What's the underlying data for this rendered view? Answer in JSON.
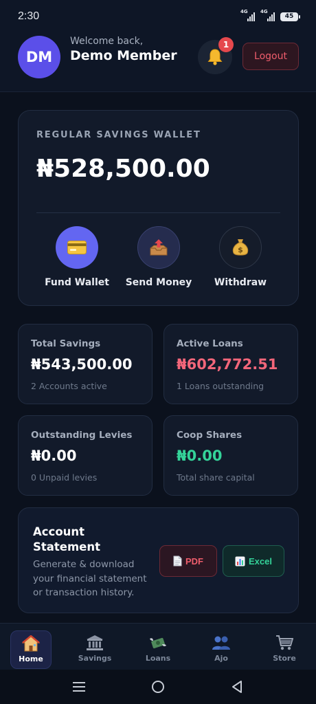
{
  "status_bar": {
    "time": "2:30",
    "signal1_label": "4G",
    "signal2_label": "4G",
    "battery": "45"
  },
  "header": {
    "avatar_initials": "DM",
    "welcome": "Welcome back,",
    "name": "Demo Member",
    "notification_count": "1",
    "logout_label": "Logout"
  },
  "wallet": {
    "label": "REGULAR SAVINGS WALLET",
    "balance": "₦528,500.00",
    "actions": [
      {
        "label": "Fund Wallet",
        "icon": "credit-card-icon",
        "color": "#6366f1"
      },
      {
        "label": "Send Money",
        "icon": "outbox-tray-icon",
        "color": "#252c4e"
      },
      {
        "label": "Withdraw",
        "icon": "money-bag-icon",
        "color": "#151c2a"
      }
    ]
  },
  "stats": [
    {
      "title": "Total Savings",
      "value": "₦543,500.00",
      "sub": "2 Accounts active",
      "color": "#ffffff"
    },
    {
      "title": "Active Loans",
      "value": "₦602,772.51",
      "sub": "1 Loans outstanding",
      "color": "#f2667a"
    },
    {
      "title": "Outstanding Levies",
      "value": "₦0.00",
      "sub": "0 Unpaid levies",
      "color": "#ffffff"
    },
    {
      "title": "Coop Shares",
      "value": "₦0.00",
      "sub": "Total share capital",
      "color": "#34d399"
    }
  ],
  "statement": {
    "title": "Account Statement",
    "description": "Generate & download your financial statement or transaction history.",
    "pdf_label": "PDF",
    "excel_label": "Excel"
  },
  "nav": {
    "items": [
      {
        "label": "Home",
        "icon": "house-icon",
        "active": true
      },
      {
        "label": "Savings",
        "icon": "bank-icon",
        "active": false
      },
      {
        "label": "Loans",
        "icon": "money-wings-icon",
        "active": false
      },
      {
        "label": "Ajo",
        "icon": "users-icon",
        "active": false
      },
      {
        "label": "Store",
        "icon": "shopping-cart-icon",
        "active": false
      }
    ]
  }
}
